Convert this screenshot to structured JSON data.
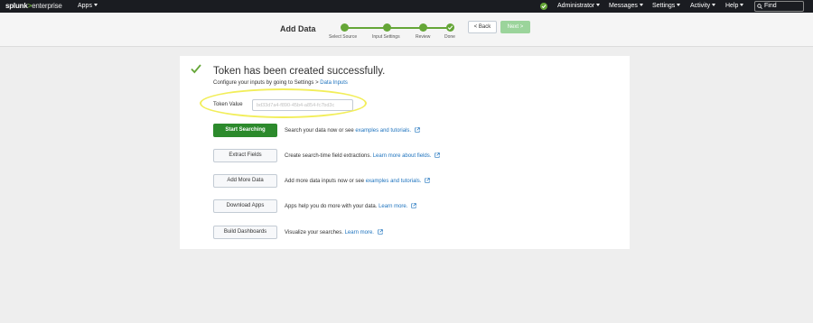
{
  "topbar": {
    "logo_brand": "splunk",
    "logo_gt": ">",
    "logo_product": "enterprise",
    "apps_label": "Apps",
    "nav_items": [
      {
        "label": "Administrator"
      },
      {
        "label": "Messages"
      },
      {
        "label": "Settings"
      },
      {
        "label": "Activity"
      },
      {
        "label": "Help"
      }
    ],
    "find_placeholder": "Find",
    "status_icon": "check-circle-icon"
  },
  "wizard": {
    "title": "Add Data",
    "steps": [
      {
        "label": "Select Source"
      },
      {
        "label": "Input Settings"
      },
      {
        "label": "Review"
      },
      {
        "label": "Done"
      }
    ],
    "back_label": "< Back",
    "next_label": "Next >"
  },
  "main": {
    "heading": "Token has been created successfully.",
    "subtext_prefix": "Configure your inputs by going to Settings > ",
    "subtext_link": "Data Inputs",
    "token_label": "Token Value",
    "token_value": "bd33d7a4-f890-45b4-a854-fc7bd3c",
    "actions": [
      {
        "button": "Start Searching",
        "desc": "Search your data now or see ",
        "link": "examples and tutorials."
      },
      {
        "button": "Extract Fields",
        "desc": "Create search-time field extractions. ",
        "link": "Learn more about fields."
      },
      {
        "button": "Add More Data",
        "desc": "Add more data inputs now or see ",
        "link": "examples and tutorials."
      },
      {
        "button": "Download Apps",
        "desc": "Apps help you do more with your data. ",
        "link": "Learn more."
      },
      {
        "button": "Build Dashboards",
        "desc": "Visualize your searches. ",
        "link": "Learn more."
      }
    ]
  },
  "colors": {
    "topbar_bg": "#1a1c21",
    "accent_green": "#65a637",
    "primary_button": "#2c8a2c",
    "link_blue": "#1e73be",
    "highlight_yellow": "#f2ee5a"
  }
}
